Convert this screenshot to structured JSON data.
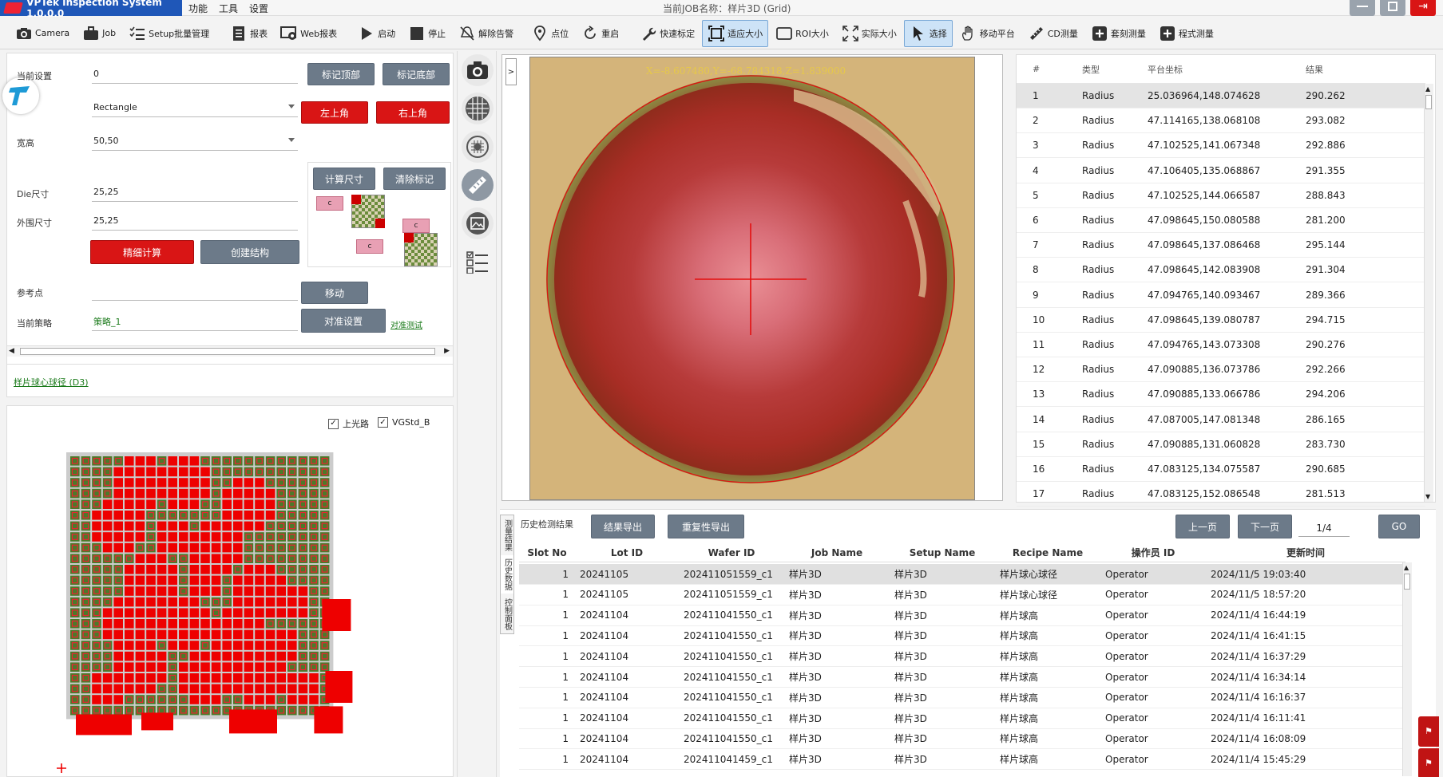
{
  "titlebar": {
    "app_title": "VPTek Inspection System 1.0.0.0",
    "menus": [
      "功能",
      "工具",
      "设置"
    ],
    "job_label": "当前JOB名称：样片3D (Grid)",
    "colors": {
      "brand": "#1f57b8",
      "close": "#d91515"
    }
  },
  "toolbar": {
    "items": [
      {
        "label": "Camera",
        "icon": "camera-icon"
      },
      {
        "label": "Job",
        "icon": "briefcase-icon"
      },
      {
        "label": "Setup批量管理",
        "icon": "checklist-icon"
      },
      {
        "label": "报表",
        "icon": "report-icon"
      },
      {
        "label": "Web报表",
        "icon": "web-report-icon"
      },
      {
        "label": "启动",
        "icon": "play-icon"
      },
      {
        "label": "停止",
        "icon": "stop-icon"
      },
      {
        "label": "解除告警",
        "icon": "bell-off-icon"
      },
      {
        "label": "点位",
        "icon": "location-pin-icon"
      },
      {
        "label": "重启",
        "icon": "restart-icon"
      },
      {
        "label": "快速标定",
        "icon": "wrench-icon"
      },
      {
        "label": "适应大小",
        "icon": "fit-size-icon"
      },
      {
        "label": "ROI大小",
        "icon": "roi-rect-icon"
      },
      {
        "label": "实际大小",
        "icon": "actual-size-icon"
      },
      {
        "label": "选择",
        "icon": "pointer-icon"
      },
      {
        "label": "移动平台",
        "icon": "hand-icon"
      },
      {
        "label": "CD测量",
        "icon": "ruler-icon"
      },
      {
        "label": "套刻测量",
        "icon": "plus-box-icon"
      },
      {
        "label": "程式测量",
        "icon": "plus-box-icon"
      }
    ],
    "active": [
      "适应大小",
      "选择"
    ]
  },
  "setup": {
    "label_current": "当前设置",
    "value_current": "0",
    "label_shape": "",
    "value_shape": "Rectangle",
    "label_wh": "宽高",
    "value_wh": "50,50",
    "label_die": "Die尺寸",
    "value_die": "25,25",
    "label_outer": "外围尺寸",
    "value_outer": "25,25",
    "label_ref": "参考点",
    "value_ref": "",
    "label_strategy": "当前策略",
    "value_strategy": "策略_1",
    "buttons": {
      "mark_top": "标记顶部",
      "mark_bottom": "标记底部",
      "top_left": "左上角",
      "top_right": "右上角",
      "calc_size": "计算尺寸",
      "clear_mark": "清除标记",
      "fine_calc": "精细计算",
      "create_struct": "创建结构",
      "move": "移动",
      "align_setup": "对准设置",
      "align_test": "对准测试"
    },
    "diagram_labels": [
      "c",
      "c",
      "c"
    ],
    "recipe_link": "样片球心球径 (D3)"
  },
  "wafer": {
    "check_top_light": "上光路",
    "check_vgstd": "VGStd_B",
    "top_light_checked": true,
    "vgstd_checked": true
  },
  "viewer": {
    "expand_label": ">",
    "coord_text": "X=-8.607480,Y=-68.784318,Z=1.839000"
  },
  "results": {
    "headers": [
      "#",
      "类型",
      "平台坐标",
      "结果"
    ],
    "rows": [
      [
        "1",
        "Radius",
        "25.036964,148.074628",
        "290.262"
      ],
      [
        "2",
        "Radius",
        "47.114165,138.068108",
        "293.082"
      ],
      [
        "3",
        "Radius",
        "47.102525,141.067348",
        "292.886"
      ],
      [
        "4",
        "Radius",
        "47.106405,135.068867",
        "291.355"
      ],
      [
        "5",
        "Radius",
        "47.102525,144.066587",
        "288.843"
      ],
      [
        "6",
        "Radius",
        "47.098645,150.080588",
        "281.200"
      ],
      [
        "7",
        "Radius",
        "47.098645,137.086468",
        "295.144"
      ],
      [
        "8",
        "Radius",
        "47.098645,142.083908",
        "291.304"
      ],
      [
        "9",
        "Radius",
        "47.094765,140.093467",
        "289.366"
      ],
      [
        "10",
        "Radius",
        "47.098645,139.080787",
        "294.715"
      ],
      [
        "11",
        "Radius",
        "47.094765,143.073308",
        "290.276"
      ],
      [
        "12",
        "Radius",
        "47.090885,136.073786",
        "292.266"
      ],
      [
        "13",
        "Radius",
        "47.090885,133.066786",
        "294.206"
      ],
      [
        "14",
        "Radius",
        "47.087005,147.081348",
        "286.165"
      ],
      [
        "15",
        "Radius",
        "47.090885,131.060828",
        "283.730"
      ],
      [
        "16",
        "Radius",
        "47.083125,134.075587",
        "290.685"
      ],
      [
        "17",
        "Radius",
        "47.083125,152.086548",
        "281.513"
      ]
    ]
  },
  "history": {
    "tabs": [
      "测量结果",
      "历史数据",
      "控制面板"
    ],
    "section_label": "历史检测结果",
    "export_results": "结果导出",
    "export_repeat": "重复性导出",
    "prev_page": "上一页",
    "next_page": "下一页",
    "page": "1/4",
    "go": "GO",
    "headers": [
      "Slot No",
      "Lot ID",
      "Wafer ID",
      "Job Name",
      "Setup Name",
      "Recipe Name",
      "操作员 ID",
      "更新时间"
    ],
    "rows": [
      [
        "1",
        "20241105",
        "202411051559_c1",
        "样片3D",
        "样片3D",
        "样片球心球径",
        "Operator",
        "2024/11/5 19:03:40"
      ],
      [
        "1",
        "20241105",
        "202411051559_c1",
        "样片3D",
        "样片3D",
        "样片球心球径",
        "Operator",
        "2024/11/5 18:57:20"
      ],
      [
        "1",
        "20241104",
        "202411041550_c1",
        "样片3D",
        "样片3D",
        "样片球高",
        "Operator",
        "2024/11/4 16:44:19"
      ],
      [
        "1",
        "20241104",
        "202411041550_c1",
        "样片3D",
        "样片3D",
        "样片球高",
        "Operator",
        "2024/11/4 16:41:15"
      ],
      [
        "1",
        "20241104",
        "202411041550_c1",
        "样片3D",
        "样片3D",
        "样片球高",
        "Operator",
        "2024/11/4 16:37:29"
      ],
      [
        "1",
        "20241104",
        "202411041550_c1",
        "样片3D",
        "样片3D",
        "样片球高",
        "Operator",
        "2024/11/4 16:34:14"
      ],
      [
        "1",
        "20241104",
        "202411041550_c1",
        "样片3D",
        "样片3D",
        "样片球高",
        "Operator",
        "2024/11/4 16:16:37"
      ],
      [
        "1",
        "20241104",
        "202411041550_c1",
        "样片3D",
        "样片3D",
        "样片球高",
        "Operator",
        "2024/11/4 16:11:41"
      ],
      [
        "1",
        "20241104",
        "202411041550_c1",
        "样片3D",
        "样片3D",
        "样片球高",
        "Operator",
        "2024/11/4 16:08:09"
      ],
      [
        "1",
        "20241104",
        "202411041459_c1",
        "样片3D",
        "样片3D",
        "样片球高",
        "Operator",
        "2024/11/4 15:45:29"
      ]
    ]
  }
}
